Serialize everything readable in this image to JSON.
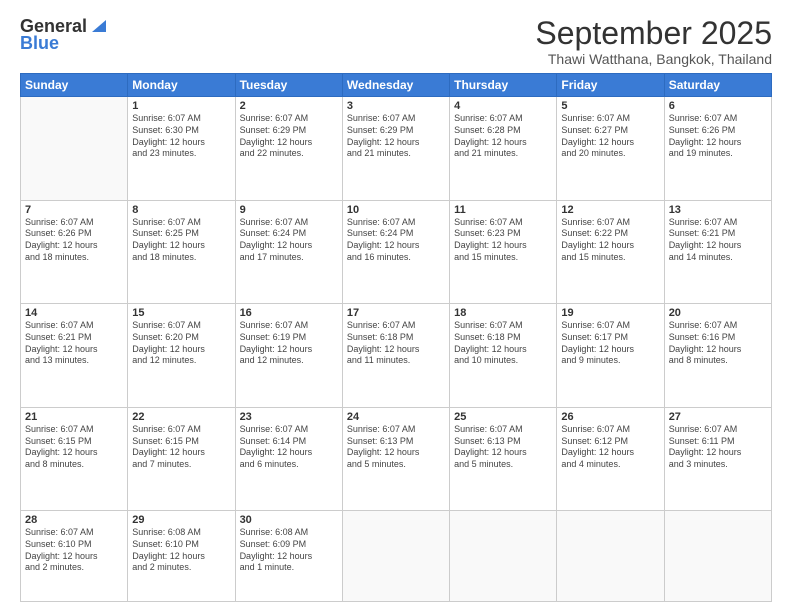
{
  "header": {
    "logo_general": "General",
    "logo_blue": "Blue",
    "month_title": "September 2025",
    "location": "Thawi Watthana, Bangkok, Thailand"
  },
  "weekdays": [
    "Sunday",
    "Monday",
    "Tuesday",
    "Wednesday",
    "Thursday",
    "Friday",
    "Saturday"
  ],
  "weeks": [
    [
      {
        "day": "",
        "info": ""
      },
      {
        "day": "1",
        "info": "Sunrise: 6:07 AM\nSunset: 6:30 PM\nDaylight: 12 hours\nand 23 minutes."
      },
      {
        "day": "2",
        "info": "Sunrise: 6:07 AM\nSunset: 6:29 PM\nDaylight: 12 hours\nand 22 minutes."
      },
      {
        "day": "3",
        "info": "Sunrise: 6:07 AM\nSunset: 6:29 PM\nDaylight: 12 hours\nand 21 minutes."
      },
      {
        "day": "4",
        "info": "Sunrise: 6:07 AM\nSunset: 6:28 PM\nDaylight: 12 hours\nand 21 minutes."
      },
      {
        "day": "5",
        "info": "Sunrise: 6:07 AM\nSunset: 6:27 PM\nDaylight: 12 hours\nand 20 minutes."
      },
      {
        "day": "6",
        "info": "Sunrise: 6:07 AM\nSunset: 6:26 PM\nDaylight: 12 hours\nand 19 minutes."
      }
    ],
    [
      {
        "day": "7",
        "info": "Sunrise: 6:07 AM\nSunset: 6:26 PM\nDaylight: 12 hours\nand 18 minutes."
      },
      {
        "day": "8",
        "info": "Sunrise: 6:07 AM\nSunset: 6:25 PM\nDaylight: 12 hours\nand 18 minutes."
      },
      {
        "day": "9",
        "info": "Sunrise: 6:07 AM\nSunset: 6:24 PM\nDaylight: 12 hours\nand 17 minutes."
      },
      {
        "day": "10",
        "info": "Sunrise: 6:07 AM\nSunset: 6:24 PM\nDaylight: 12 hours\nand 16 minutes."
      },
      {
        "day": "11",
        "info": "Sunrise: 6:07 AM\nSunset: 6:23 PM\nDaylight: 12 hours\nand 15 minutes."
      },
      {
        "day": "12",
        "info": "Sunrise: 6:07 AM\nSunset: 6:22 PM\nDaylight: 12 hours\nand 15 minutes."
      },
      {
        "day": "13",
        "info": "Sunrise: 6:07 AM\nSunset: 6:21 PM\nDaylight: 12 hours\nand 14 minutes."
      }
    ],
    [
      {
        "day": "14",
        "info": "Sunrise: 6:07 AM\nSunset: 6:21 PM\nDaylight: 12 hours\nand 13 minutes."
      },
      {
        "day": "15",
        "info": "Sunrise: 6:07 AM\nSunset: 6:20 PM\nDaylight: 12 hours\nand 12 minutes."
      },
      {
        "day": "16",
        "info": "Sunrise: 6:07 AM\nSunset: 6:19 PM\nDaylight: 12 hours\nand 12 minutes."
      },
      {
        "day": "17",
        "info": "Sunrise: 6:07 AM\nSunset: 6:18 PM\nDaylight: 12 hours\nand 11 minutes."
      },
      {
        "day": "18",
        "info": "Sunrise: 6:07 AM\nSunset: 6:18 PM\nDaylight: 12 hours\nand 10 minutes."
      },
      {
        "day": "19",
        "info": "Sunrise: 6:07 AM\nSunset: 6:17 PM\nDaylight: 12 hours\nand 9 minutes."
      },
      {
        "day": "20",
        "info": "Sunrise: 6:07 AM\nSunset: 6:16 PM\nDaylight: 12 hours\nand 8 minutes."
      }
    ],
    [
      {
        "day": "21",
        "info": "Sunrise: 6:07 AM\nSunset: 6:15 PM\nDaylight: 12 hours\nand 8 minutes."
      },
      {
        "day": "22",
        "info": "Sunrise: 6:07 AM\nSunset: 6:15 PM\nDaylight: 12 hours\nand 7 minutes."
      },
      {
        "day": "23",
        "info": "Sunrise: 6:07 AM\nSunset: 6:14 PM\nDaylight: 12 hours\nand 6 minutes."
      },
      {
        "day": "24",
        "info": "Sunrise: 6:07 AM\nSunset: 6:13 PM\nDaylight: 12 hours\nand 5 minutes."
      },
      {
        "day": "25",
        "info": "Sunrise: 6:07 AM\nSunset: 6:13 PM\nDaylight: 12 hours\nand 5 minutes."
      },
      {
        "day": "26",
        "info": "Sunrise: 6:07 AM\nSunset: 6:12 PM\nDaylight: 12 hours\nand 4 minutes."
      },
      {
        "day": "27",
        "info": "Sunrise: 6:07 AM\nSunset: 6:11 PM\nDaylight: 12 hours\nand 3 minutes."
      }
    ],
    [
      {
        "day": "28",
        "info": "Sunrise: 6:07 AM\nSunset: 6:10 PM\nDaylight: 12 hours\nand 2 minutes."
      },
      {
        "day": "29",
        "info": "Sunrise: 6:08 AM\nSunset: 6:10 PM\nDaylight: 12 hours\nand 2 minutes."
      },
      {
        "day": "30",
        "info": "Sunrise: 6:08 AM\nSunset: 6:09 PM\nDaylight: 12 hours\nand 1 minute."
      },
      {
        "day": "",
        "info": ""
      },
      {
        "day": "",
        "info": ""
      },
      {
        "day": "",
        "info": ""
      },
      {
        "day": "",
        "info": ""
      }
    ]
  ]
}
